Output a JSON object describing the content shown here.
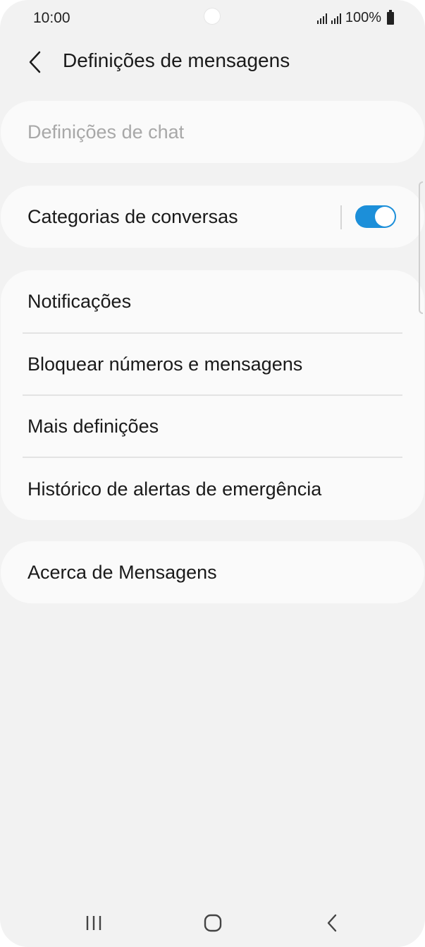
{
  "status_bar": {
    "time": "10:00",
    "battery_text": "100%",
    "icons": [
      "camera-cutout",
      "signal-icon",
      "signal-icon",
      "battery-icon"
    ]
  },
  "header": {
    "back_icon": "chevron-left-icon",
    "title": "Definições de mensagens"
  },
  "sections": {
    "chat": {
      "label": "Definições de chat",
      "enabled": false
    },
    "categories": {
      "label": "Categorias de conversas",
      "toggle_on": true
    },
    "main_list": [
      {
        "label": "Notificações"
      },
      {
        "label": "Bloquear números e mensagens"
      },
      {
        "label": "Mais definições"
      },
      {
        "label": "Histórico de alertas de emergência"
      }
    ],
    "about": {
      "label": "Acerca de Mensagens"
    }
  },
  "nav_bar": {
    "buttons": [
      "recent-apps-icon",
      "home-icon",
      "back-icon"
    ]
  },
  "colors": {
    "background": "#f2f2f2",
    "card": "#fafafa",
    "accent": "#1c8fd9",
    "disabled_text": "#a8a8a8",
    "text": "#1a1a1a"
  }
}
